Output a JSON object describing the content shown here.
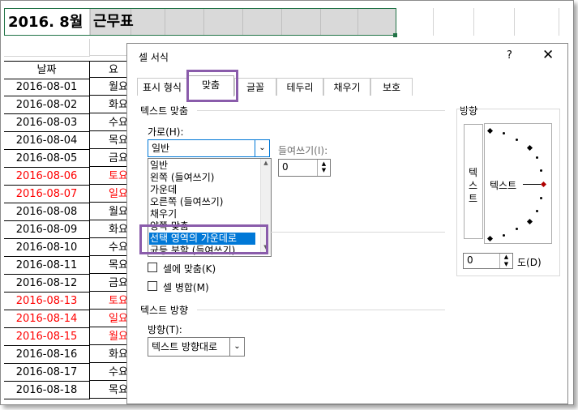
{
  "sheet": {
    "title": "2016. 8월",
    "title_merged": "근무표",
    "header": [
      "날짜",
      "요"
    ],
    "rows": [
      {
        "date": "2016-08-01",
        "day": "월요",
        "red": false
      },
      {
        "date": "2016-08-02",
        "day": "화요",
        "red": false
      },
      {
        "date": "2016-08-03",
        "day": "수요",
        "red": false
      },
      {
        "date": "2016-08-04",
        "day": "목요",
        "red": false
      },
      {
        "date": "2016-08-05",
        "day": "금요",
        "red": false
      },
      {
        "date": "2016-08-06",
        "day": "토요",
        "red": true
      },
      {
        "date": "2016-08-07",
        "day": "일요",
        "red": true
      },
      {
        "date": "2016-08-08",
        "day": "월요",
        "red": false
      },
      {
        "date": "2016-08-09",
        "day": "화요",
        "red": false
      },
      {
        "date": "2016-08-10",
        "day": "수요",
        "red": false
      },
      {
        "date": "2016-08-11",
        "day": "목요",
        "red": false
      },
      {
        "date": "2016-08-12",
        "day": "금요",
        "red": false
      },
      {
        "date": "2016-08-13",
        "day": "토요",
        "red": true
      },
      {
        "date": "2016-08-14",
        "day": "일요",
        "red": true
      },
      {
        "date": "2016-08-15",
        "day": "월요",
        "red": true
      },
      {
        "date": "2016-08-16",
        "day": "화요",
        "red": false
      },
      {
        "date": "2016-08-17",
        "day": "수요",
        "red": false
      },
      {
        "date": "2016-08-18",
        "day": "목요",
        "red": false
      }
    ],
    "colors": {
      "red": "#ff0000",
      "selection_border": "#217346",
      "merged_fill": "#d9d9d9"
    }
  },
  "dialog": {
    "title": "셀 서식",
    "help": "?",
    "close": "✕",
    "tabs": [
      "표시 형식",
      "맞춤",
      "글꼴",
      "테두리",
      "채우기",
      "보호"
    ],
    "active_tab": "맞춤",
    "text_alignment_label": "텍스트 맞춤",
    "horizontal_label": "가로(H):",
    "horizontal_value": "일반",
    "horizontal_options": [
      "일반",
      "왼쪽 (들여쓰기)",
      "가운데",
      "오른쪽 (들여쓰기)",
      "채우기",
      "양쪽 맞춤",
      "선택 영역의 가운데로",
      "균등 분할 (들여쓰기)"
    ],
    "selected_option": "선택 영역의 가운데로",
    "indent_label": "들여쓰기(I):",
    "indent_value": "0",
    "shrink_label": "셀에 맞춤(K)",
    "merge_label": "셀 병합(M)",
    "text_direction_label": "텍스트 방향",
    "direction_label": "방향(T):",
    "direction_value": "텍스트 방향대로",
    "orientation_label": "방향",
    "vertical_text": [
      "텍",
      "스",
      "트"
    ],
    "dial_text": "텍스트",
    "degree_value": "0",
    "degree_label": "도(D)",
    "highlight_color": "#8a5cab",
    "selection_color": "#0078d7"
  }
}
